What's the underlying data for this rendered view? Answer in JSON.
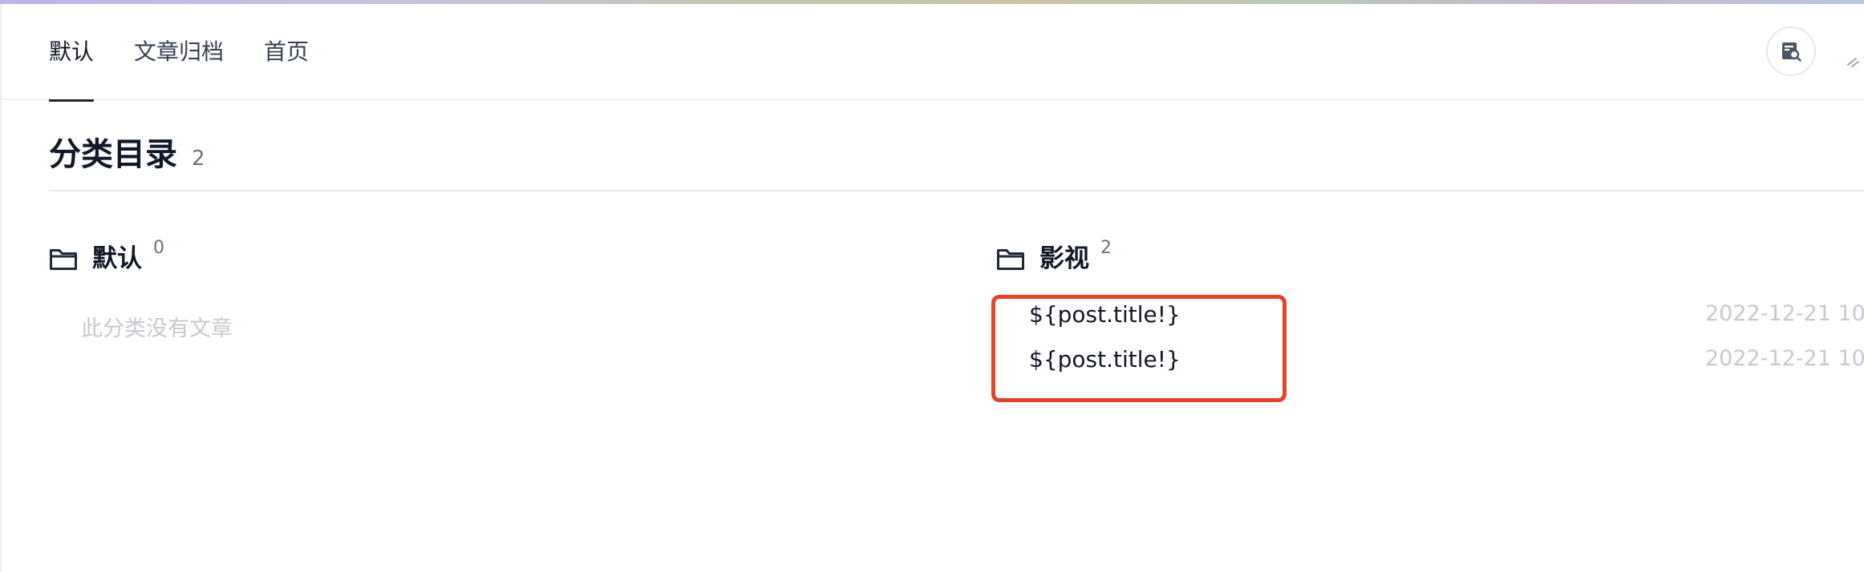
{
  "nav": {
    "tabs": [
      {
        "label": "默认",
        "active": true
      },
      {
        "label": "文章归档",
        "active": false
      },
      {
        "label": "首页",
        "active": false
      }
    ]
  },
  "page": {
    "title": "分类目录",
    "count": "2"
  },
  "categories": [
    {
      "name": "默认",
      "count": "0",
      "empty_text": "此分类没有文章"
    },
    {
      "name": "影视",
      "count": "2",
      "posts": [
        {
          "title": "${post.title!}",
          "date": "2022-12-21 10:"
        },
        {
          "title": "${post.title!}",
          "date": "2022-12-21 10:"
        }
      ]
    }
  ],
  "icons": {
    "search": "search-doc-icon",
    "folder": "folder-icon",
    "extra": "partial-icon"
  },
  "colors": {
    "highlight": "#e0452b",
    "muted_text": "#c5c9cf"
  }
}
